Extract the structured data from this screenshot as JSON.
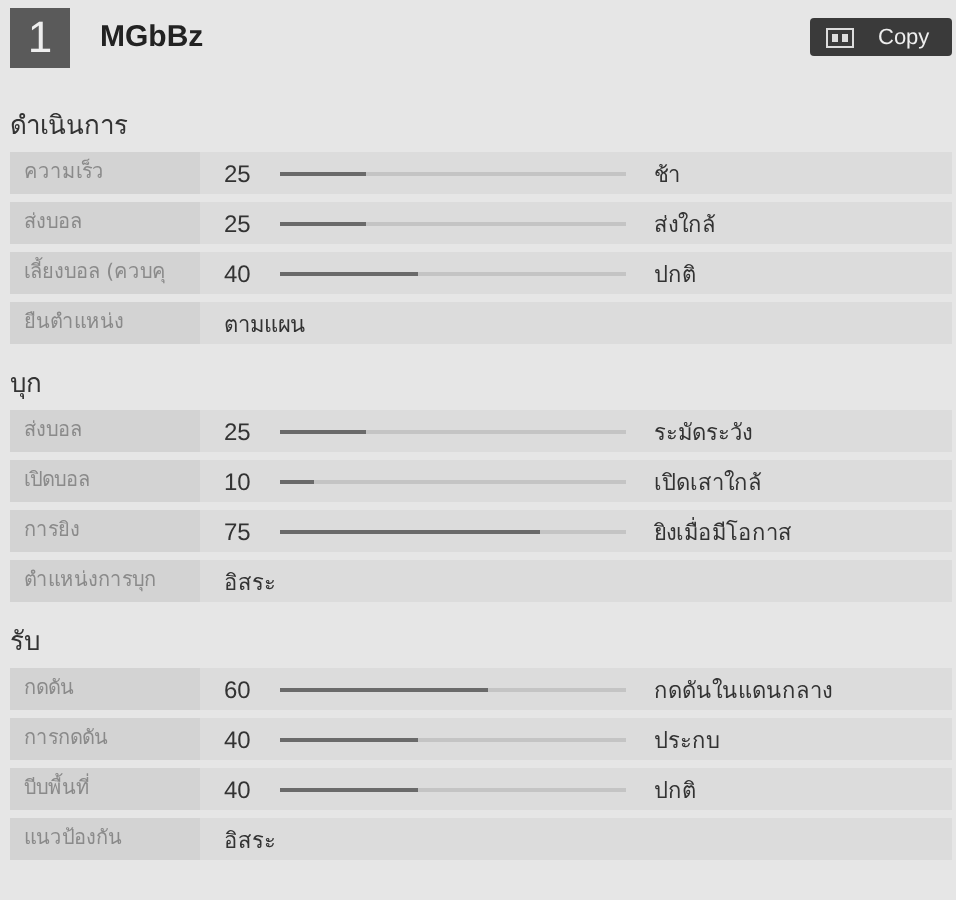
{
  "header": {
    "number": "1",
    "title": "MGbBz",
    "copy_button": "Copy"
  },
  "sections": [
    {
      "title": "ดำเนินการ",
      "rows": [
        {
          "kind": "slider",
          "label": "ความเร็ว",
          "value": "25",
          "level": 0.25,
          "setting": "ช้า"
        },
        {
          "kind": "slider",
          "label": "ส่งบอล",
          "value": "25",
          "level": 0.25,
          "setting": "ส่งใกล้"
        },
        {
          "kind": "slider",
          "label": "เลี้ยงบอล (ควบคุ",
          "value": "40",
          "level": 0.4,
          "setting": "ปกติ"
        },
        {
          "kind": "text",
          "label": "ยืนตำแหน่ง",
          "setting": "ตามแผน"
        }
      ]
    },
    {
      "title": "บุก",
      "rows": [
        {
          "kind": "slider",
          "label": "ส่งบอล",
          "value": "25",
          "level": 0.25,
          "setting": "ระมัดระวัง"
        },
        {
          "kind": "slider",
          "label": "เปิดบอล",
          "value": "10",
          "level": 0.1,
          "setting": "เปิดเสาใกล้"
        },
        {
          "kind": "slider",
          "label": "การยิง",
          "value": "75",
          "level": 0.75,
          "setting": "ยิงเมื่อมีโอกาส"
        },
        {
          "kind": "text",
          "label": "ตำแหน่งการบุก",
          "setting": "อิสระ"
        }
      ]
    },
    {
      "title": "รับ",
      "rows": [
        {
          "kind": "slider",
          "label": "กดดัน",
          "value": "60",
          "level": 0.6,
          "setting": "กดดันในแดนกลาง"
        },
        {
          "kind": "slider",
          "label": "การกดดัน",
          "value": "40",
          "level": 0.4,
          "setting": "ประกบ"
        },
        {
          "kind": "slider",
          "label": "บีบพื้นที่",
          "value": "40",
          "level": 0.4,
          "setting": "ปกติ"
        },
        {
          "kind": "text",
          "label": "แนวป้องกัน",
          "setting": "อิสระ"
        }
      ]
    }
  ]
}
